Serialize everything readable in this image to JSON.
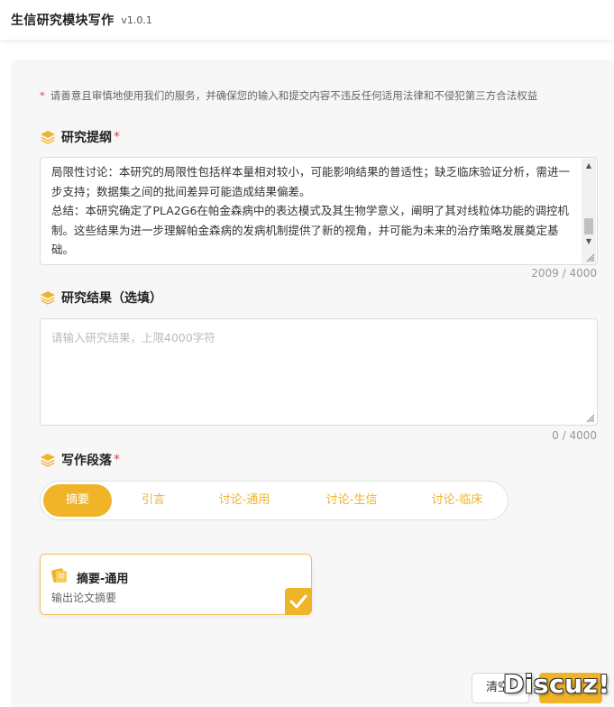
{
  "header": {
    "title": "生信研究模块写作",
    "version": "v1.0.1"
  },
  "notice": {
    "star": "*",
    "text": "请善意且审慎地使用我们的服务，并确保您的输入和提交内容不违反任何适用法律和不侵犯第三方合法权益"
  },
  "outline": {
    "label": "研究提纲",
    "required_mark": "*",
    "value": "局限性讨论：本研究的局限性包括样本量相对较小，可能影响结果的普适性；缺乏临床验证分析，需进一步支持；数据集之间的批间差异可能造成结果偏差。\n总结：本研究确定了PLA2G6在帕金森病中的表达模式及其生物学意义，阐明了其对线粒体功能的调控机制。这些结果为进一步理解帕金森病的发病机制提供了新的视角，并可能为未来的治疗策略发展奠定基础。",
    "counter": "2009 / 4000"
  },
  "results": {
    "label": "研究结果（选填）",
    "placeholder": "请输入研究结果，上限4000字符",
    "counter": "0 / 4000"
  },
  "sections": {
    "label": "写作段落",
    "required_mark": "*",
    "tabs": [
      {
        "label": "摘要",
        "active": true
      },
      {
        "label": "引言",
        "active": false
      },
      {
        "label": "讨论-通用",
        "active": false
      },
      {
        "label": "讨论-生信",
        "active": false
      },
      {
        "label": "讨论-临床",
        "active": false
      }
    ]
  },
  "card": {
    "title": "摘要-通用",
    "description": "输出论文摘要",
    "selected": true
  },
  "footer": {
    "clear_label": "清空",
    "watermark": "Discuz!"
  },
  "colors": {
    "accent": "#f0b429",
    "required": "#e04040"
  }
}
